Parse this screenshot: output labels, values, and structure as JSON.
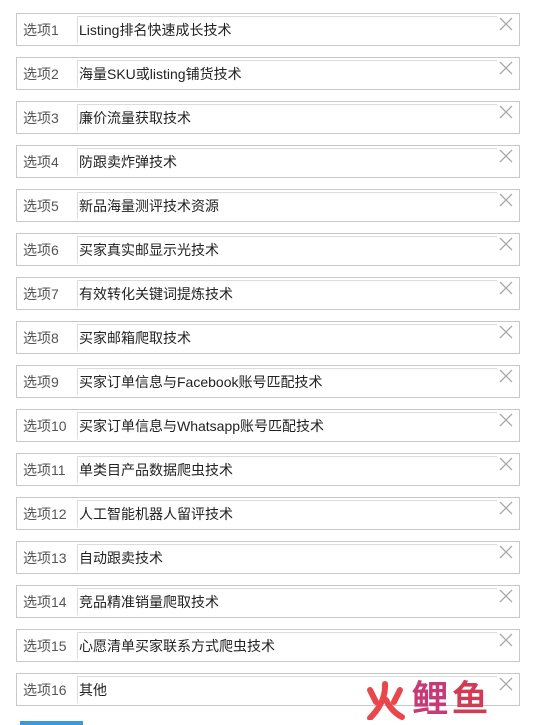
{
  "options": [
    {
      "label": "选项1",
      "value": "Listing排名快速成长技术"
    },
    {
      "label": "选项2",
      "value": "海量SKU或listing铺货技术"
    },
    {
      "label": "选项3",
      "value": "廉价流量获取技术"
    },
    {
      "label": "选项4",
      "value": "防跟卖炸弹技术"
    },
    {
      "label": "选项5",
      "value": "新品海量测评技术资源"
    },
    {
      "label": "选项6",
      "value": "买家真实邮显示光技术"
    },
    {
      "label": "选项7",
      "value": "有效转化关键词提炼技术"
    },
    {
      "label": "选项8",
      "value": "买家邮箱爬取技术"
    },
    {
      "label": "选项9",
      "value": "买家订单信息与Facebook账号匹配技术"
    },
    {
      "label": "选项10",
      "value": "买家订单信息与Whatsapp账号匹配技术"
    },
    {
      "label": "选项11",
      "value": "单类目产品数据爬虫技术"
    },
    {
      "label": "选项12",
      "value": "人工智能机器人留评技术"
    },
    {
      "label": "选项13",
      "value": "自动跟卖技术"
    },
    {
      "label": "选项14",
      "value": "竞品精准销量爬取技术"
    },
    {
      "label": "选项15",
      "value": "心愿清单买家联系方式爬虫技术"
    },
    {
      "label": "选项16",
      "value": "其他"
    }
  ],
  "icons": {
    "remove": "close-icon"
  },
  "watermark": {
    "text": "火鲤鱼",
    "colors": {
      "huo": "#e8484c",
      "li": "#c63a78",
      "yu": "#d23b55"
    }
  },
  "colors": {
    "row_border": "#c8c8c8",
    "accent": "#3a9ad9",
    "remove_icon": "#a8a8a8"
  }
}
